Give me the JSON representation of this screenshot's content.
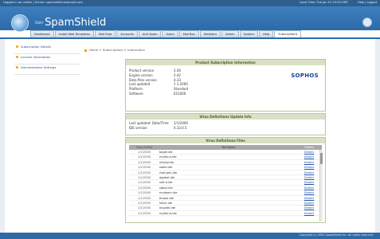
{
  "topbar": {
    "left_text": "Logged in as: admin | Server: spamshield.example.com",
    "right_text": "Local Time: Tue Jan 01 10:00 GMT",
    "help_text": "Help | Logout"
  },
  "brand": {
    "prefix": "Gen",
    "name": "SpamShield",
    "logo_icon": "globe-logo-icon",
    "corner_icon": "help-circle-icon"
  },
  "nav": {
    "tabs": [
      "Dashboard",
      "Install Web Templates",
      "Mail Flow",
      "Accounts",
      "Anti-Spam",
      "Users",
      "Mail Box",
      "Statistics",
      "Admin",
      "System",
      "Help",
      "Subscriptions"
    ],
    "active_index": 11
  },
  "sidebar": {
    "items": [
      "Subscription Details",
      "License Information",
      "Administrative Settings"
    ]
  },
  "breadcrumb": "Home > Subscriptions > Information",
  "product_panel": {
    "title": "Product Subscription Information",
    "rows": [
      {
        "key": "Product version",
        "value": "2.40"
      },
      {
        "key": "Engine version",
        "value": "2.42"
      },
      {
        "key": "Data files version",
        "value": "4.33"
      },
      {
        "key": "Last updated",
        "value": "1.1.2000"
      },
      {
        "key": "Platform",
        "value": "Standard"
      },
      {
        "key": "Software",
        "value": "ES1000"
      }
    ],
    "vendor": "SOPHOS"
  },
  "virus_panel": {
    "title": "Virus Definitions Update Info",
    "rows": [
      {
        "key": "Last updated: Date/Time",
        "value": "1/1/2000"
      },
      {
        "key": "IDE version",
        "value": "4.33.0.5"
      }
    ]
  },
  "list_panel": {
    "title": "Virus Definitions Files",
    "columns": [
      "Date Added",
      "File Name",
      "Details"
    ],
    "rows": [
      {
        "date": "1/1/2000",
        "name": "bagle.ide",
        "details": "Details"
      },
      {
        "date": "1/1/2000",
        "name": "mytob-a.ide",
        "details": "Details"
      },
      {
        "date": "1/1/2000",
        "name": "netsky.ide",
        "details": "Details"
      },
      {
        "date": "1/1/2000",
        "name": "sober.ide",
        "details": "Details"
      },
      {
        "date": "1/1/2000",
        "name": "rbot-gen.ide",
        "details": "Details"
      },
      {
        "date": "1/1/2000",
        "name": "agobot.ide",
        "details": "Details"
      },
      {
        "date": "1/1/2000",
        "name": "zafi-d.ide",
        "details": "Details"
      },
      {
        "date": "1/1/2000",
        "name": "sdbot.ide",
        "details": "Details"
      },
      {
        "date": "1/1/2000",
        "name": "mydoom.ide",
        "details": "Details"
      },
      {
        "date": "1/1/2000",
        "name": "bropia.ide",
        "details": "Details"
      },
      {
        "date": "1/1/2000",
        "name": "kelvir.ide",
        "details": "Details"
      },
      {
        "date": "1/1/2000",
        "name": "lovgate.ide",
        "details": "Details"
      },
      {
        "date": "1/1/2000",
        "name": "mytob-b.ide",
        "details": "Details"
      }
    ]
  },
  "footer": "Copyright (c) 2005 SpamShield Inc. All rights reserved."
}
